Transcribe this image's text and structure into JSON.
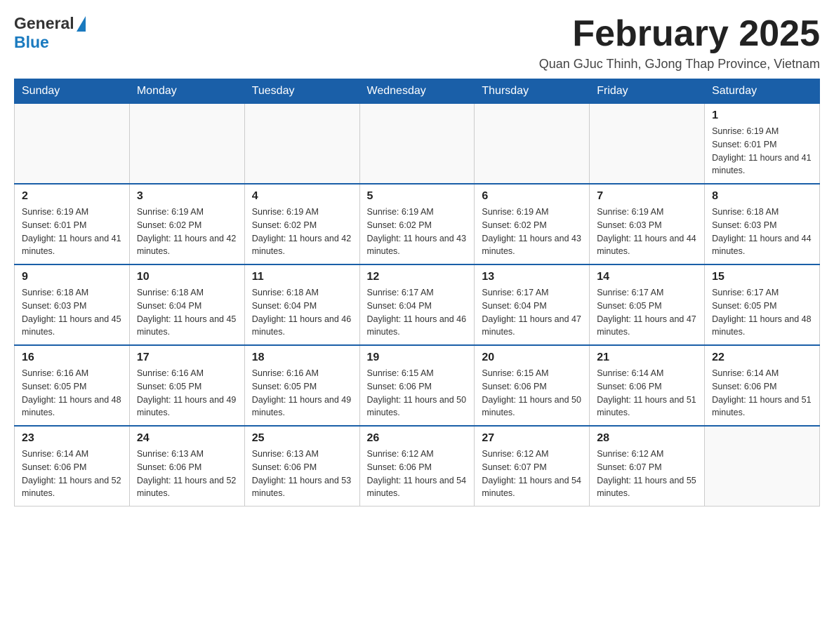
{
  "header": {
    "logo_general": "General",
    "logo_blue": "Blue",
    "main_title": "February 2025",
    "subtitle": "Quan GJuc Thinh, GJong Thap Province, Vietnam"
  },
  "calendar": {
    "days_of_week": [
      "Sunday",
      "Monday",
      "Tuesday",
      "Wednesday",
      "Thursday",
      "Friday",
      "Saturday"
    ],
    "weeks": [
      [
        {
          "day": "",
          "info": ""
        },
        {
          "day": "",
          "info": ""
        },
        {
          "day": "",
          "info": ""
        },
        {
          "day": "",
          "info": ""
        },
        {
          "day": "",
          "info": ""
        },
        {
          "day": "",
          "info": ""
        },
        {
          "day": "1",
          "info": "Sunrise: 6:19 AM\nSunset: 6:01 PM\nDaylight: 11 hours and 41 minutes."
        }
      ],
      [
        {
          "day": "2",
          "info": "Sunrise: 6:19 AM\nSunset: 6:01 PM\nDaylight: 11 hours and 41 minutes."
        },
        {
          "day": "3",
          "info": "Sunrise: 6:19 AM\nSunset: 6:02 PM\nDaylight: 11 hours and 42 minutes."
        },
        {
          "day": "4",
          "info": "Sunrise: 6:19 AM\nSunset: 6:02 PM\nDaylight: 11 hours and 42 minutes."
        },
        {
          "day": "5",
          "info": "Sunrise: 6:19 AM\nSunset: 6:02 PM\nDaylight: 11 hours and 43 minutes."
        },
        {
          "day": "6",
          "info": "Sunrise: 6:19 AM\nSunset: 6:02 PM\nDaylight: 11 hours and 43 minutes."
        },
        {
          "day": "7",
          "info": "Sunrise: 6:19 AM\nSunset: 6:03 PM\nDaylight: 11 hours and 44 minutes."
        },
        {
          "day": "8",
          "info": "Sunrise: 6:18 AM\nSunset: 6:03 PM\nDaylight: 11 hours and 44 minutes."
        }
      ],
      [
        {
          "day": "9",
          "info": "Sunrise: 6:18 AM\nSunset: 6:03 PM\nDaylight: 11 hours and 45 minutes."
        },
        {
          "day": "10",
          "info": "Sunrise: 6:18 AM\nSunset: 6:04 PM\nDaylight: 11 hours and 45 minutes."
        },
        {
          "day": "11",
          "info": "Sunrise: 6:18 AM\nSunset: 6:04 PM\nDaylight: 11 hours and 46 minutes."
        },
        {
          "day": "12",
          "info": "Sunrise: 6:17 AM\nSunset: 6:04 PM\nDaylight: 11 hours and 46 minutes."
        },
        {
          "day": "13",
          "info": "Sunrise: 6:17 AM\nSunset: 6:04 PM\nDaylight: 11 hours and 47 minutes."
        },
        {
          "day": "14",
          "info": "Sunrise: 6:17 AM\nSunset: 6:05 PM\nDaylight: 11 hours and 47 minutes."
        },
        {
          "day": "15",
          "info": "Sunrise: 6:17 AM\nSunset: 6:05 PM\nDaylight: 11 hours and 48 minutes."
        }
      ],
      [
        {
          "day": "16",
          "info": "Sunrise: 6:16 AM\nSunset: 6:05 PM\nDaylight: 11 hours and 48 minutes."
        },
        {
          "day": "17",
          "info": "Sunrise: 6:16 AM\nSunset: 6:05 PM\nDaylight: 11 hours and 49 minutes."
        },
        {
          "day": "18",
          "info": "Sunrise: 6:16 AM\nSunset: 6:05 PM\nDaylight: 11 hours and 49 minutes."
        },
        {
          "day": "19",
          "info": "Sunrise: 6:15 AM\nSunset: 6:06 PM\nDaylight: 11 hours and 50 minutes."
        },
        {
          "day": "20",
          "info": "Sunrise: 6:15 AM\nSunset: 6:06 PM\nDaylight: 11 hours and 50 minutes."
        },
        {
          "day": "21",
          "info": "Sunrise: 6:14 AM\nSunset: 6:06 PM\nDaylight: 11 hours and 51 minutes."
        },
        {
          "day": "22",
          "info": "Sunrise: 6:14 AM\nSunset: 6:06 PM\nDaylight: 11 hours and 51 minutes."
        }
      ],
      [
        {
          "day": "23",
          "info": "Sunrise: 6:14 AM\nSunset: 6:06 PM\nDaylight: 11 hours and 52 minutes."
        },
        {
          "day": "24",
          "info": "Sunrise: 6:13 AM\nSunset: 6:06 PM\nDaylight: 11 hours and 52 minutes."
        },
        {
          "day": "25",
          "info": "Sunrise: 6:13 AM\nSunset: 6:06 PM\nDaylight: 11 hours and 53 minutes."
        },
        {
          "day": "26",
          "info": "Sunrise: 6:12 AM\nSunset: 6:06 PM\nDaylight: 11 hours and 54 minutes."
        },
        {
          "day": "27",
          "info": "Sunrise: 6:12 AM\nSunset: 6:07 PM\nDaylight: 11 hours and 54 minutes."
        },
        {
          "day": "28",
          "info": "Sunrise: 6:12 AM\nSunset: 6:07 PM\nDaylight: 11 hours and 55 minutes."
        },
        {
          "day": "",
          "info": ""
        }
      ]
    ]
  }
}
